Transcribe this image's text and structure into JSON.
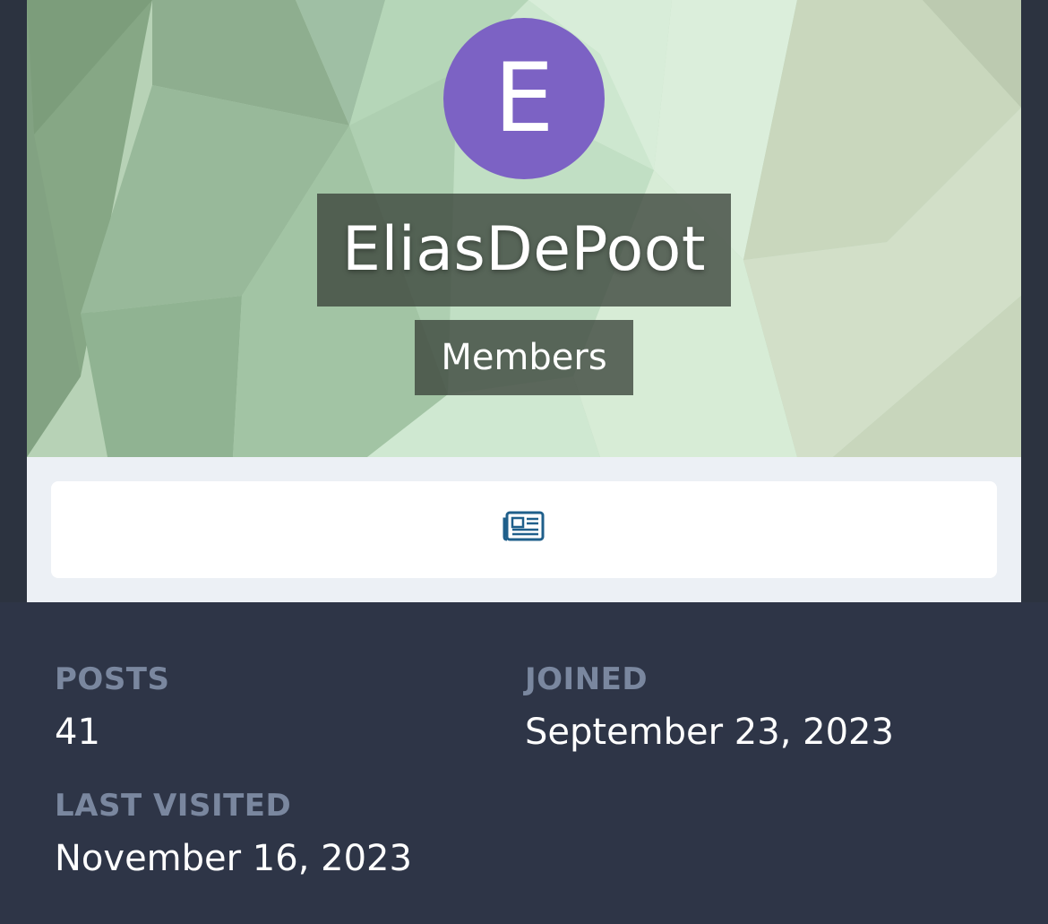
{
  "profile": {
    "avatar_letter": "E",
    "avatar_color": "#7c62c4",
    "username": "EliasDePoot",
    "group": "Members"
  },
  "tabs": [
    {
      "icon": "newspaper-icon",
      "accent": "#1f5f8b"
    }
  ],
  "stats": {
    "posts_label": "POSTS",
    "posts_value": "41",
    "joined_label": "JOINED",
    "joined_value": "September 23, 2023",
    "visited_label": "LAST VISITED",
    "visited_value": "November 16, 2023"
  },
  "colors": {
    "label": "#7a879f",
    "value": "#ffffff",
    "background": "#2e3547",
    "tab_area": "#ecf0f5"
  }
}
